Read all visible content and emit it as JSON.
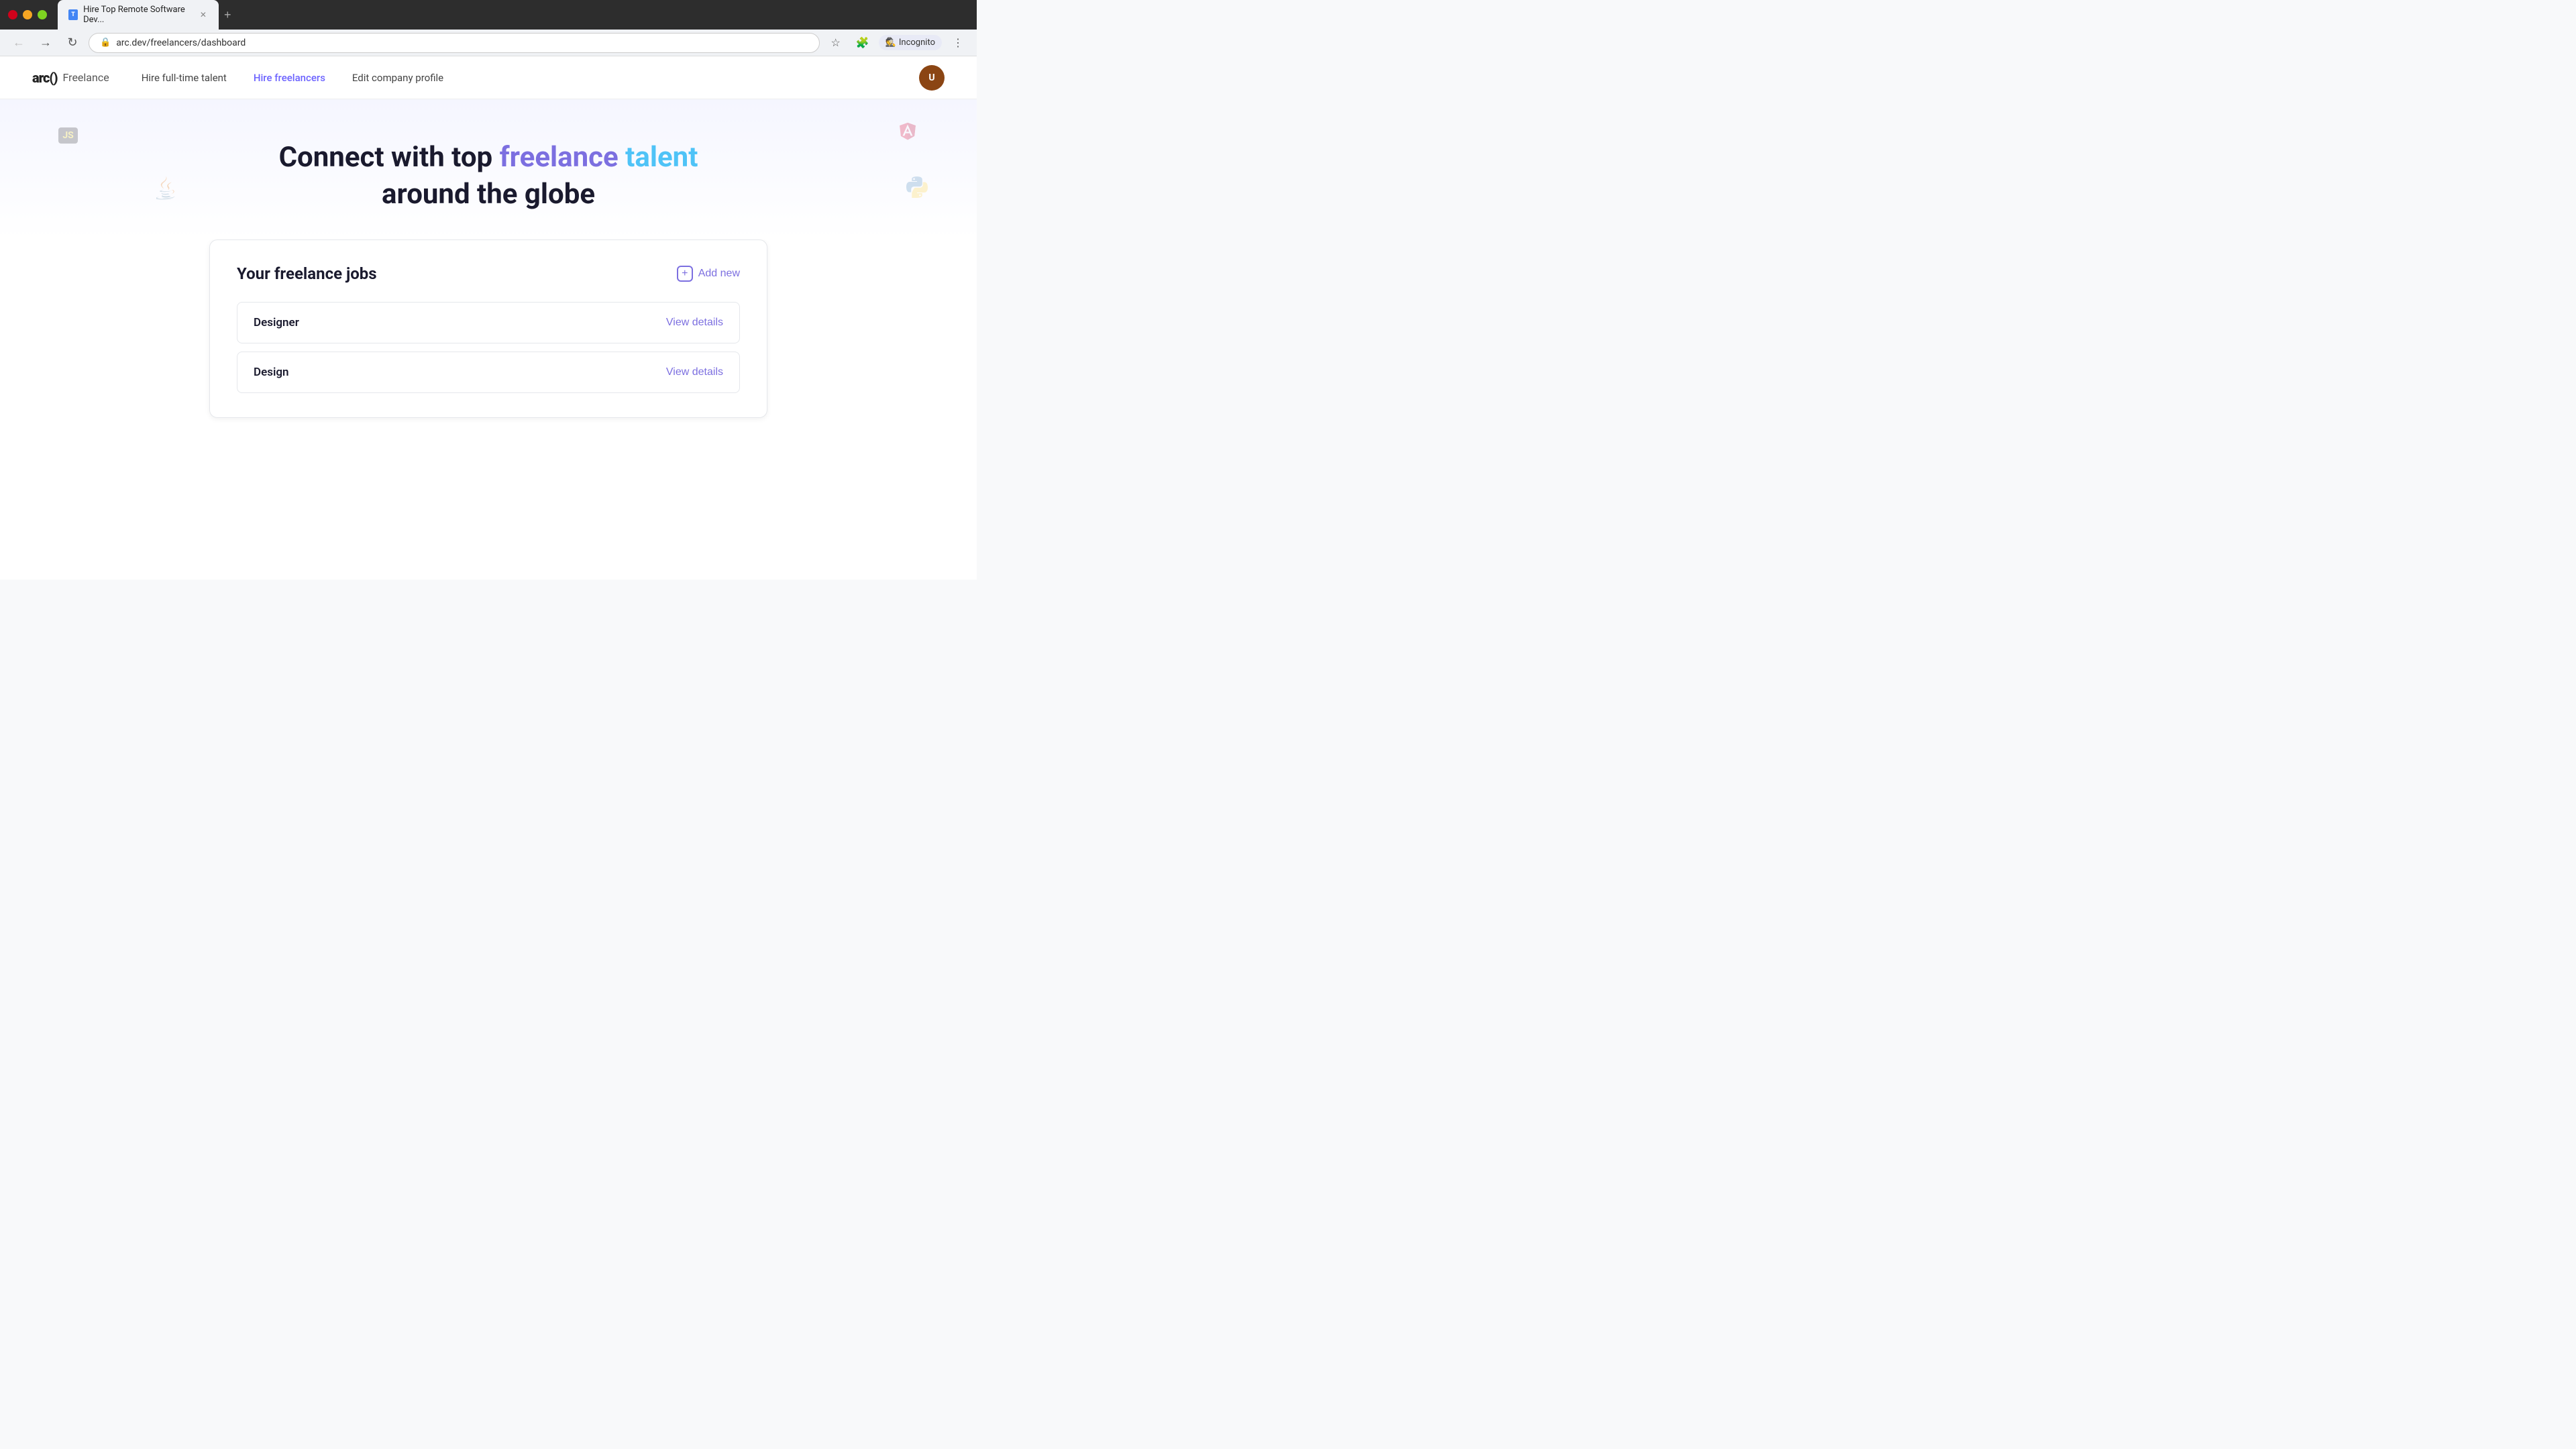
{
  "browser": {
    "tab_title": "Hire Top Remote Software Dev...",
    "tab_favicon": "T",
    "url": "arc.dev/freelancers/dashboard",
    "incognito_label": "Incognito",
    "new_tab_symbol": "+"
  },
  "navbar": {
    "logo_arc": "arc()",
    "logo_freelance": "Freelance",
    "links": [
      {
        "id": "hire-full-time",
        "label": "Hire full-time talent",
        "active": false
      },
      {
        "id": "hire-freelancers",
        "label": "Hire freelancers",
        "active": true
      },
      {
        "id": "edit-company",
        "label": "Edit company profile",
        "active": false
      }
    ],
    "avatar_initials": "U"
  },
  "hero": {
    "title_part1": "Connect with top ",
    "title_accent1": "freelance",
    "title_space": " ",
    "title_accent2": "talent",
    "title_part2": "around the globe"
  },
  "jobs": {
    "section_title": "Your freelance jobs",
    "add_new_label": "Add new",
    "items": [
      {
        "id": "job-1",
        "name": "Designer",
        "view_label": "View details"
      },
      {
        "id": "job-2",
        "name": "Design",
        "view_label": "View details"
      }
    ]
  }
}
